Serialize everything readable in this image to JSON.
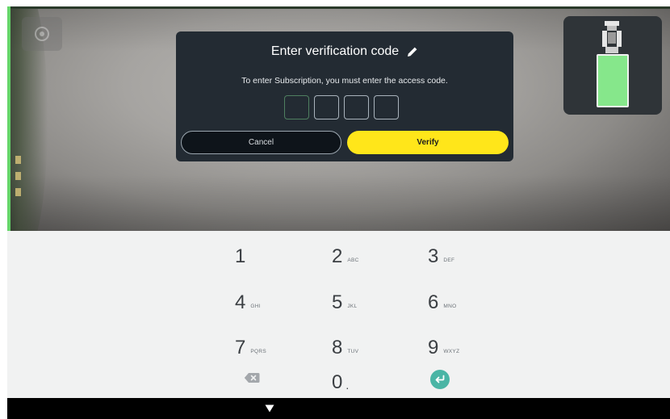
{
  "dialog": {
    "title": "Enter verification code",
    "message": "To enter Subscription, you must enter the access code.",
    "code_length": 4,
    "cancel_label": "Cancel",
    "verify_label": "Verify",
    "edit_icon": "pencil-icon"
  },
  "keypad": {
    "keys": [
      {
        "digit": "1",
        "letters": ""
      },
      {
        "digit": "2",
        "letters": "ABC"
      },
      {
        "digit": "3",
        "letters": "DEF"
      },
      {
        "digit": "4",
        "letters": "GHI"
      },
      {
        "digit": "5",
        "letters": "JKL"
      },
      {
        "digit": "6",
        "letters": "MNO"
      },
      {
        "digit": "7",
        "letters": "PQRS"
      },
      {
        "digit": "8",
        "letters": "TUV"
      },
      {
        "digit": "9",
        "letters": "WXYZ"
      }
    ],
    "zero": {
      "digit": "0",
      "extra": "."
    },
    "backspace_icon": "backspace-icon",
    "enter_icon": "enter-icon"
  },
  "nav": {
    "down_icon": "chevron-down-icon"
  },
  "vehicle": {
    "icon": "vehicle-top-view-icon"
  },
  "colors": {
    "accent_yellow": "#ffe61a",
    "vehicle_green": "#86e78b",
    "enter_teal": "#4ab5a5",
    "dialog_bg": "#232b33"
  }
}
